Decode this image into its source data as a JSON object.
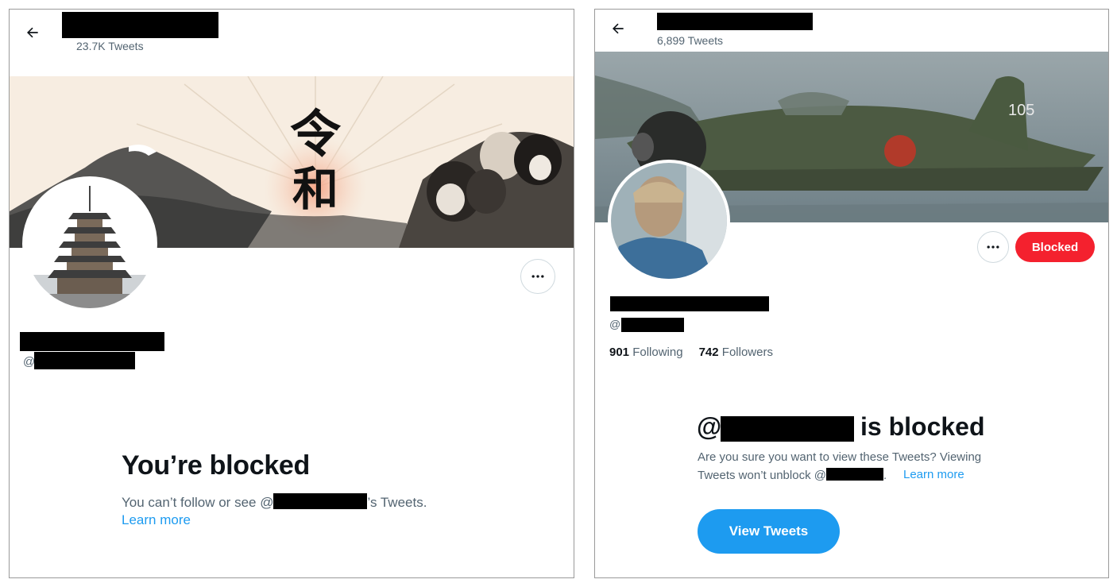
{
  "left": {
    "header": {
      "tweet_count": "23.7K Tweets"
    },
    "handle_prefix": "@",
    "blocked": {
      "title": "You’re blocked",
      "desc_prefix": "You can’t follow or see @",
      "desc_suffix": "’s Tweets.",
      "learn_more": "Learn more"
    },
    "banner_text": "令和",
    "icons": {
      "back": "arrow-left-icon",
      "more": "more-horizontal-icon"
    }
  },
  "right": {
    "header": {
      "tweet_count": "6,899 Tweets"
    },
    "handle_prefix": "@",
    "blocked_button": "Blocked",
    "stats": {
      "following_count": "901",
      "following_label": "Following",
      "followers_count": "742",
      "followers_label": "Followers"
    },
    "blocked": {
      "title_prefix": "@",
      "title_suffix": "is blocked",
      "desc_line1": "Are you sure you want to view these Tweets? Viewing",
      "desc_line2_prefix": "Tweets won’t unblock @",
      "desc_line2_suffix": ".",
      "learn_more": "Learn more",
      "view_button": "View Tweets"
    },
    "plane_number": "105",
    "icons": {
      "back": "arrow-left-icon",
      "more": "more-horizontal-icon"
    }
  },
  "colors": {
    "accent": "#1d9bf0",
    "blocked": "#f4212e",
    "muted": "#536471"
  }
}
